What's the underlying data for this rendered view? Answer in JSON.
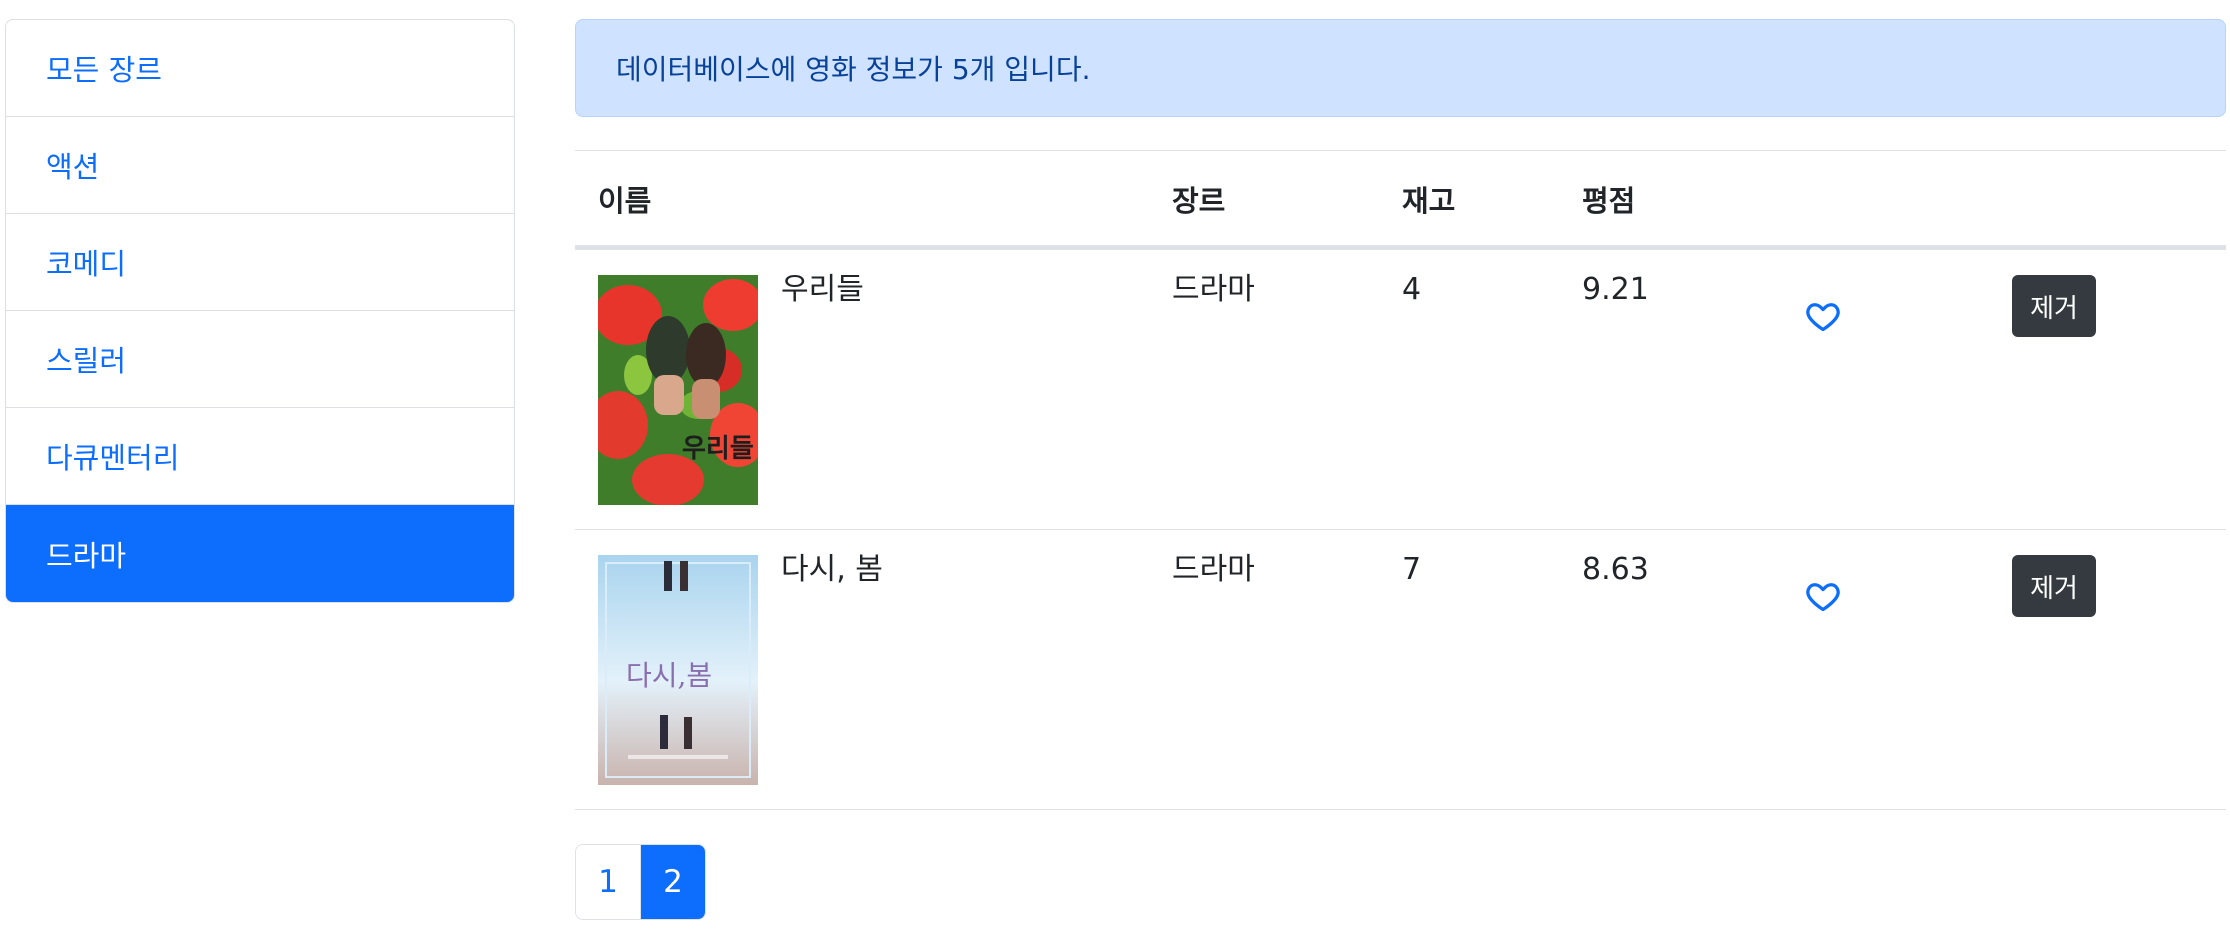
{
  "sidebar": {
    "items": [
      {
        "label": "모든 장르"
      },
      {
        "label": "액션"
      },
      {
        "label": "코메디"
      },
      {
        "label": "스릴러"
      },
      {
        "label": "다큐멘터리"
      },
      {
        "label": "드라마",
        "active": true
      }
    ]
  },
  "alert": {
    "text": "데이터베이스에 영화 정보가 5개 입니다."
  },
  "table": {
    "headers": {
      "name": "이름",
      "genre": "장르",
      "stock": "재고",
      "rating": "평점"
    },
    "rows": [
      {
        "title": "우리들",
        "genre": "드라마",
        "stock": "4",
        "rating": "9.21",
        "poster_title": "우리들",
        "liked": false,
        "remove_label": "제거"
      },
      {
        "title": "다시, 봄",
        "genre": "드라마",
        "stock": "7",
        "rating": "8.63",
        "poster_title": "다시,봄",
        "liked": false,
        "remove_label": "제거"
      }
    ]
  },
  "pagination": {
    "pages": [
      "1",
      "2"
    ],
    "current": "2"
  },
  "colors": {
    "primary": "#0d6efd",
    "alert_bg": "#cfe2ff",
    "dark_button": "#343a40"
  }
}
